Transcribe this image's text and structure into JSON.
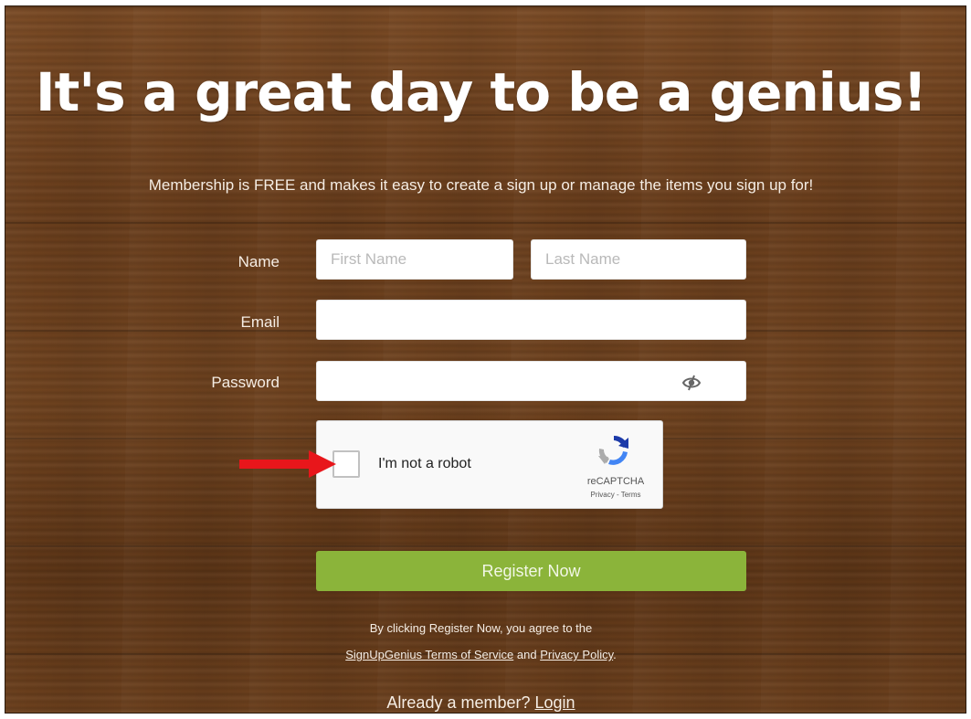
{
  "page": {
    "headline": "It's a great day to be a genius!",
    "subheadline": "Membership is FREE and makes it easy to create a sign up or manage the items you sign up for!"
  },
  "form": {
    "name_label": "Name",
    "first_name": {
      "placeholder": "First Name",
      "value": ""
    },
    "last_name": {
      "placeholder": "Last Name",
      "value": ""
    },
    "email_label": "Email",
    "email": {
      "placeholder": "",
      "value": ""
    },
    "password_label": "Password",
    "password": {
      "placeholder": "",
      "value": ""
    },
    "show_password_icon": "eye-slash-icon",
    "submit_label": "Register Now"
  },
  "captcha": {
    "checkbox_label": "I'm not a robot",
    "checked": false,
    "brand": "reCAPTCHA",
    "privacy_link": "Privacy",
    "separator": "-",
    "terms_link": "Terms"
  },
  "annotation": {
    "arrow_color": "#e8161b"
  },
  "legal": {
    "prefix": "By clicking Register Now, you agree to the",
    "tos_link": "SignUpGenius Terms of Service",
    "and": "and",
    "privacy_link": "Privacy Policy",
    "period": "."
  },
  "footer": {
    "member_text": "Already a member?",
    "login_link": "Login"
  },
  "colors": {
    "register_button": "#8bb43a",
    "background_wood": "#6b3f1d",
    "text_light": "#f5ede4"
  }
}
